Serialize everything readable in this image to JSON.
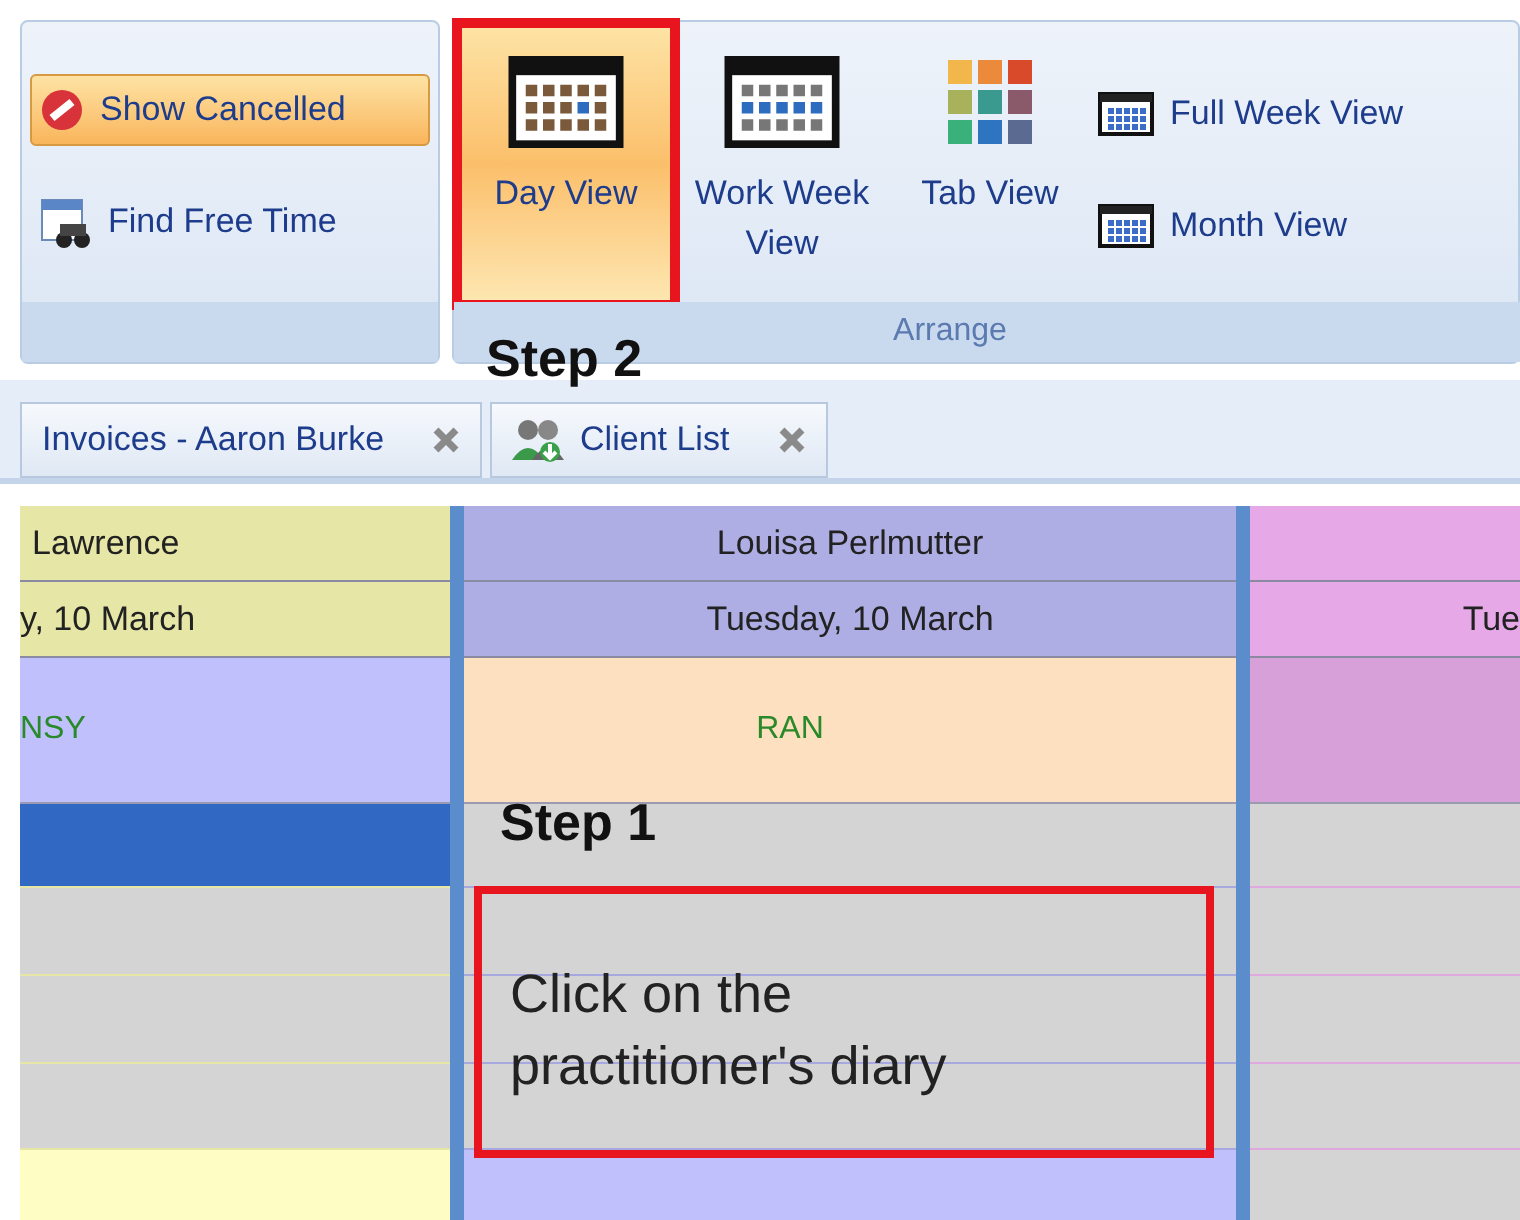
{
  "ribbon": {
    "groups": [
      {
        "buttons": [
          {
            "kind": "toggle",
            "label": "Show Cancelled",
            "selected": true
          },
          {
            "kind": "small",
            "label": "Find Free Time",
            "selected": false
          }
        ]
      },
      {
        "label": "Arrange",
        "buttons": [
          {
            "kind": "large",
            "label": "Day View",
            "selected": true,
            "outlined": true
          },
          {
            "kind": "large",
            "label": "Work Week View",
            "selected": false,
            "outlined": false
          },
          {
            "kind": "large",
            "label": "Tab View",
            "selected": false,
            "outlined": false
          },
          {
            "kind": "small",
            "label": "Full Week View",
            "selected": false
          },
          {
            "kind": "small",
            "label": "Month View",
            "selected": false
          }
        ]
      }
    ]
  },
  "tabs": [
    {
      "label": "Invoices - Aaron Burke"
    },
    {
      "label": "Client List"
    }
  ],
  "columns": [
    {
      "name": "Lawrence",
      "date": "y, 10 March",
      "color": "#e6e6a6",
      "appointment": {
        "label": "NSY",
        "color": "#c0c0fc"
      },
      "slots": [
        {
          "selected": true
        },
        {
          "selected": false
        },
        {
          "selected": false
        },
        {
          "selected": false
        }
      ],
      "next_appointment": {
        "color": "#fdfdc4"
      }
    },
    {
      "name": "Louisa Perlmutter",
      "date": "Tuesday, 10 March",
      "color": "#aeaee4",
      "appointment": {
        "label": "RAN",
        "color": "#fde0c0"
      },
      "slots": [
        {
          "selected": false
        },
        {
          "selected": false
        },
        {
          "selected": false
        },
        {
          "selected": false
        }
      ],
      "next_appointment": {
        "color": "#c0c0fc"
      }
    },
    {
      "date": "Tue",
      "color": "#e6a8e6",
      "appointment": {
        "color": "#d8a0d8"
      },
      "slots": [
        {
          "selected": false
        },
        {
          "selected": false
        },
        {
          "selected": false
        },
        {
          "selected": false
        }
      ],
      "next_appointment": {
        "color": "#d4d4d4"
      }
    }
  ],
  "annotations": [
    {
      "kind": "step",
      "text": "Step 2"
    },
    {
      "kind": "step",
      "text": "Step 1"
    },
    {
      "kind": "callout",
      "text": "Click on the practitioner's diary"
    }
  ]
}
